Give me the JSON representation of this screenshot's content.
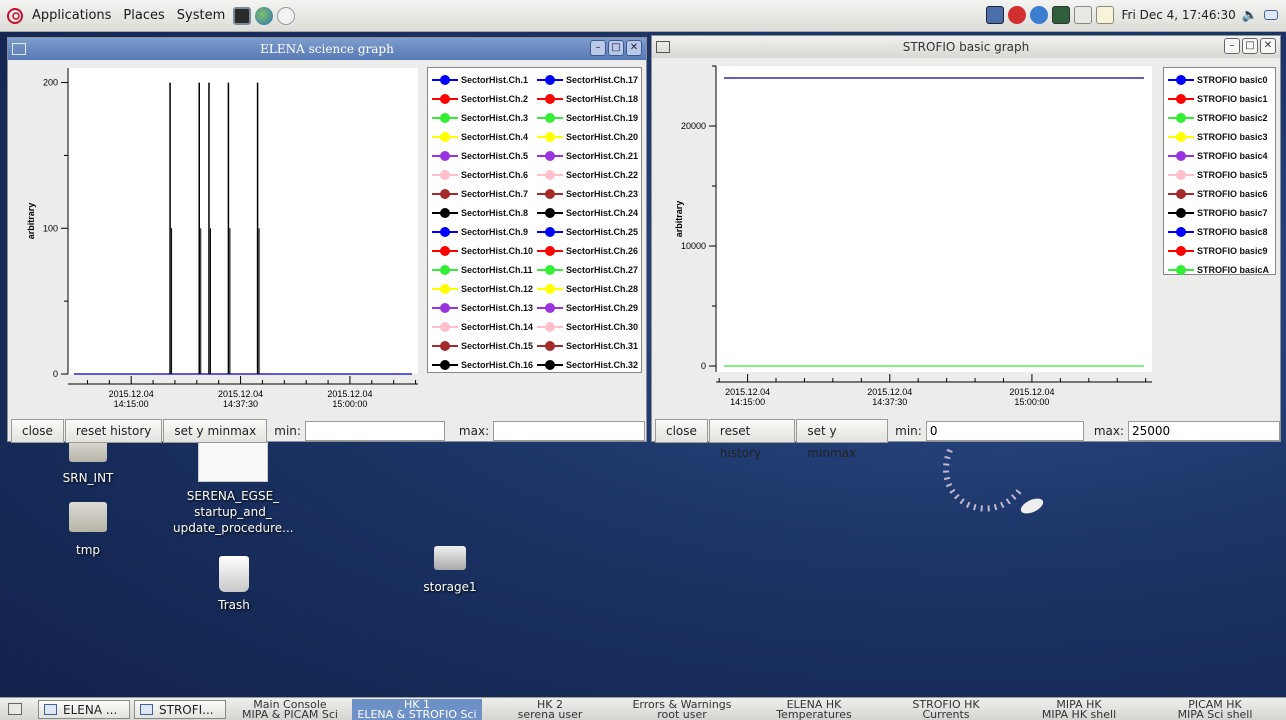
{
  "top_panel": {
    "menu": [
      "Applications",
      "Places",
      "System"
    ],
    "clock": "Fri Dec  4, 17:46:30"
  },
  "elena_window": {
    "title": "ELENA science graph",
    "y_axis_label": "arbitrary",
    "legend": [
      {
        "name": "SectorHist.Ch.1",
        "color": "#0000ff"
      },
      {
        "name": "SectorHist.Ch.2",
        "color": "#ff0000"
      },
      {
        "name": "SectorHist.Ch.3",
        "color": "#33ee33"
      },
      {
        "name": "SectorHist.Ch.4",
        "color": "#ffff00"
      },
      {
        "name": "SectorHist.Ch.5",
        "color": "#9933dd"
      },
      {
        "name": "SectorHist.Ch.6",
        "color": "#ffc0cb"
      },
      {
        "name": "SectorHist.Ch.7",
        "color": "#a52a2a"
      },
      {
        "name": "SectorHist.Ch.8",
        "color": "#000000"
      },
      {
        "name": "SectorHist.Ch.9",
        "color": "#0000ff"
      },
      {
        "name": "SectorHist.Ch.10",
        "color": "#ff0000"
      },
      {
        "name": "SectorHist.Ch.11",
        "color": "#33ee33"
      },
      {
        "name": "SectorHist.Ch.12",
        "color": "#ffff00"
      },
      {
        "name": "SectorHist.Ch.13",
        "color": "#9933dd"
      },
      {
        "name": "SectorHist.Ch.14",
        "color": "#ffc0cb"
      },
      {
        "name": "SectorHist.Ch.15",
        "color": "#a52a2a"
      },
      {
        "name": "SectorHist.Ch.16",
        "color": "#000000"
      },
      {
        "name": "SectorHist.Ch.17",
        "color": "#0000ff"
      },
      {
        "name": "SectorHist.Ch.18",
        "color": "#ff0000"
      },
      {
        "name": "SectorHist.Ch.19",
        "color": "#33ee33"
      },
      {
        "name": "SectorHist.Ch.20",
        "color": "#ffff00"
      },
      {
        "name": "SectorHist.Ch.21",
        "color": "#9933dd"
      },
      {
        "name": "SectorHist.Ch.22",
        "color": "#ffc0cb"
      },
      {
        "name": "SectorHist.Ch.23",
        "color": "#a52a2a"
      },
      {
        "name": "SectorHist.Ch.24",
        "color": "#000000"
      },
      {
        "name": "SectorHist.Ch.25",
        "color": "#0000ff"
      },
      {
        "name": "SectorHist.Ch.26",
        "color": "#ff0000"
      },
      {
        "name": "SectorHist.Ch.27",
        "color": "#33ee33"
      },
      {
        "name": "SectorHist.Ch.28",
        "color": "#ffff00"
      },
      {
        "name": "SectorHist.Ch.29",
        "color": "#9933dd"
      },
      {
        "name": "SectorHist.Ch.30",
        "color": "#ffc0cb"
      },
      {
        "name": "SectorHist.Ch.31",
        "color": "#a52a2a"
      },
      {
        "name": "SectorHist.Ch.32",
        "color": "#000000"
      }
    ],
    "buttons": {
      "close": "close",
      "reset": "reset history",
      "minmax": "set y minmax"
    },
    "min_label": "min:",
    "min_value": "",
    "max_label": "max:",
    "max_value": ""
  },
  "strofio_window": {
    "title": "STROFIO basic graph",
    "y_axis_label": "arbitrary",
    "legend": [
      {
        "name": "STROFIO basic0",
        "color": "#0000ff"
      },
      {
        "name": "STROFIO basic1",
        "color": "#ff0000"
      },
      {
        "name": "STROFIO basic2",
        "color": "#33ee33"
      },
      {
        "name": "STROFIO basic3",
        "color": "#ffff00"
      },
      {
        "name": "STROFIO basic4",
        "color": "#9933dd"
      },
      {
        "name": "STROFIO basic5",
        "color": "#ffc0cb"
      },
      {
        "name": "STROFIO basic6",
        "color": "#a52a2a"
      },
      {
        "name": "STROFIO basic7",
        "color": "#000000"
      },
      {
        "name": "STROFIO basic8",
        "color": "#0000ff"
      },
      {
        "name": "STROFIO basic9",
        "color": "#ff0000"
      },
      {
        "name": "STROFIO basicA",
        "color": "#33ee33"
      }
    ],
    "buttons": {
      "close": "close",
      "reset": "reset history",
      "minmax": "set y minmax"
    },
    "min_label": "min:",
    "min_value": "0",
    "max_label": "max:",
    "max_value": "25000"
  },
  "chart_data": [
    {
      "type": "line",
      "ylabel": "arbitrary",
      "ylim": [
        0,
        210
      ],
      "yticks": [
        0,
        100,
        200
      ],
      "x_range": [
        "2015-12-04 14:02:00",
        "2015-12-04 15:14:00"
      ],
      "x_ticks": [
        {
          "date": "2015.12.04",
          "time": "14:15:00"
        },
        {
          "date": "2015.12.04",
          "time": "14:37:30"
        },
        {
          "date": "2015.12.04",
          "time": "15:00:00"
        }
      ],
      "baseline": {
        "series": "SectorHist.Ch.1",
        "value": 0
      },
      "spikes": [
        {
          "time": "2015-12-04 14:23:00",
          "value": 200
        },
        {
          "time": "2015-12-04 14:29:00",
          "value": 200
        },
        {
          "time": "2015-12-04 14:31:00",
          "value": 200
        },
        {
          "time": "2015-12-04 14:35:00",
          "value": 200
        },
        {
          "time": "2015-12-04 14:41:00",
          "value": 200
        }
      ],
      "spike_tick_value": 100
    },
    {
      "type": "line",
      "ylabel": "arbitrary",
      "ylim": [
        -500,
        25000
      ],
      "yticks": [
        0,
        10000,
        20000
      ],
      "x_range": [
        "2015-12-04 14:10:00",
        "2015-12-04 15:19:00"
      ],
      "x_ticks": [
        {
          "date": "2015.12.04",
          "time": "14:15:00"
        },
        {
          "date": "2015.12.04",
          "time": "14:37:30"
        },
        {
          "date": "2015.12.04",
          "time": "15:00:00"
        }
      ],
      "series": [
        {
          "name": "STROFIO basic0",
          "value": 24000
        },
        {
          "name": "STROFIO basicA",
          "value": 0
        }
      ]
    }
  ],
  "desktop": {
    "icons": [
      "SRN_INT",
      "SERENA_EGSE_ startup_and_ update_procedure...",
      "tmp",
      "Trash",
      "storage1"
    ]
  },
  "taskbar": {
    "tasks": [
      "ELENA ...",
      "STROFI..."
    ],
    "workspaces": [
      {
        "line1": "Main Console",
        "line2": "MIPA & PICAM Sci"
      },
      {
        "line1": "HK 1",
        "line2": "ELENA & STROFIO Sci"
      },
      {
        "line1": "HK 2",
        "line2": "serena user"
      },
      {
        "line1": "Errors & Warnings",
        "line2": "root user"
      },
      {
        "line1": "ELENA HK",
        "line2": "Temperatures"
      },
      {
        "line1": "STROFIO HK",
        "line2": "Currents"
      },
      {
        "line1": "MIPA HK",
        "line2": "MIPA HK shell"
      },
      {
        "line1": "PICAM HK",
        "line2": "MIPA Sci shell"
      }
    ]
  }
}
